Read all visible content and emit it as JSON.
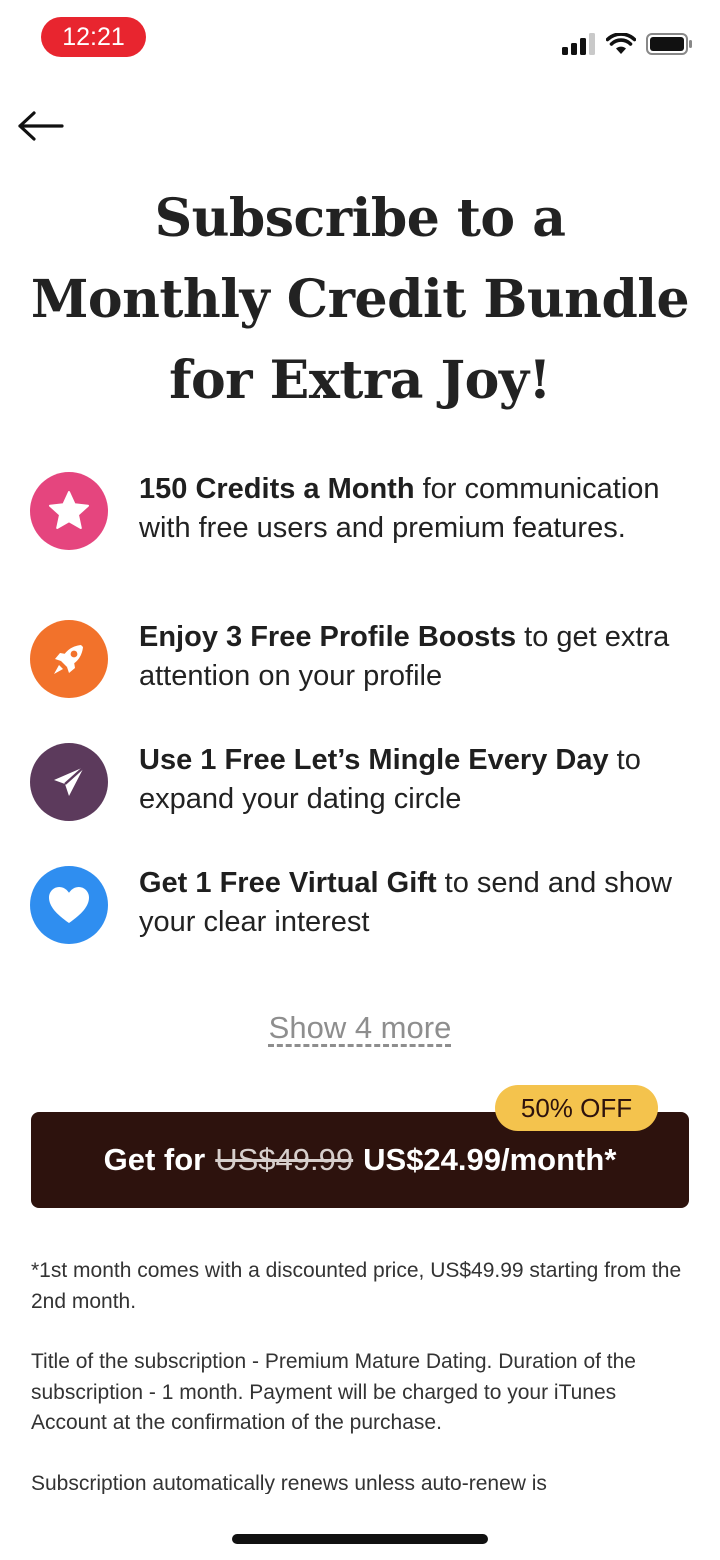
{
  "status_bar": {
    "time": "12:21"
  },
  "header": {
    "title": "Subscribe to a\nMonthly Credit Bundle\nfor Extra Joy!"
  },
  "features": [
    {
      "icon": "star-icon",
      "color": "#e5457e",
      "bold": "150 Credits a Month",
      "rest": " for communication with free users and premium features."
    },
    {
      "icon": "rocket-icon",
      "color": "#f2722b",
      "bold": "Enjoy 3 Free Profile Boosts",
      "rest": " to get extra attention on your profile"
    },
    {
      "icon": "paper-plane-icon",
      "color": "#5c3a5c",
      "bold": "Use 1 Free Let’s Mingle Every Day",
      "rest": " to expand your dating circle"
    },
    {
      "icon": "heart-icon",
      "color": "#2f8ef0",
      "bold": "Get 1 Free Virtual Gift",
      "rest": " to send and show your clear interest"
    }
  ],
  "show_more": "Show 4 more",
  "cta": {
    "badge": "50% OFF",
    "prefix": "Get for",
    "old_price": "US$49.99",
    "new_price": "US$24.99/month*"
  },
  "legal": [
    "*1st month comes with a discounted price, US$49.99 starting from the 2nd month.",
    "Title of the subscription - Premium Mature Dating. Duration of the subscription - 1 month. Payment will be charged to your iTunes Account at the confirmation of the purchase.",
    "Subscription automatically renews unless auto-renew is"
  ],
  "colors": {
    "cta_background": "#2d120d",
    "badge_background": "#f4c34d",
    "time_pill": "#e8252f"
  }
}
